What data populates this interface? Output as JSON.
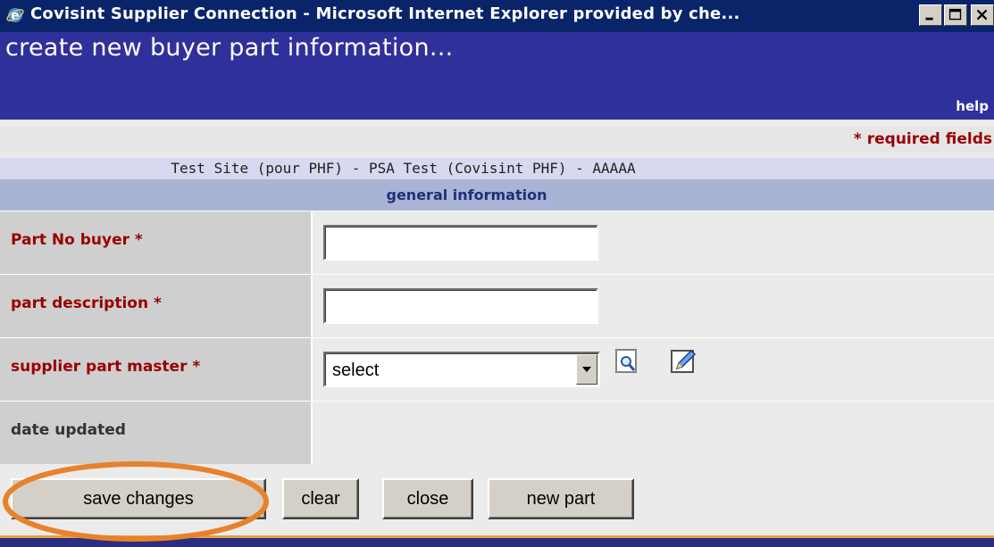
{
  "window": {
    "title": "Covisint Supplier Connection - Microsoft Internet Explorer provided by che...",
    "icons": {
      "app": "ie-icon",
      "minimize": "minimize-icon",
      "maximize": "maximize-icon",
      "close": "close-icon"
    }
  },
  "header": {
    "title": "create new buyer part information...",
    "help": "help"
  },
  "required_note": "* required fields",
  "site_info": "Test Site (pour PHF) - PSA Test (Covisint PHF) - AAAAA",
  "section": {
    "title": "general information"
  },
  "form": {
    "part_no_buyer": {
      "label": "Part No buyer *",
      "value": ""
    },
    "part_description": {
      "label": "part description *",
      "value": ""
    },
    "supplier_part_master": {
      "label": "supplier part master *",
      "selected": "select",
      "icons": [
        "search-icon",
        "edit-icon"
      ]
    },
    "date_updated": {
      "label": "date updated",
      "value": ""
    }
  },
  "buttons": {
    "save": "save changes",
    "clear": "clear",
    "close": "close",
    "new_part": "new part"
  },
  "colors": {
    "titlebar": "#0a246a",
    "header": "#30309a",
    "required_text": "#990000",
    "section_bar": "#a9b3d4",
    "highlight": "#e8822a"
  }
}
